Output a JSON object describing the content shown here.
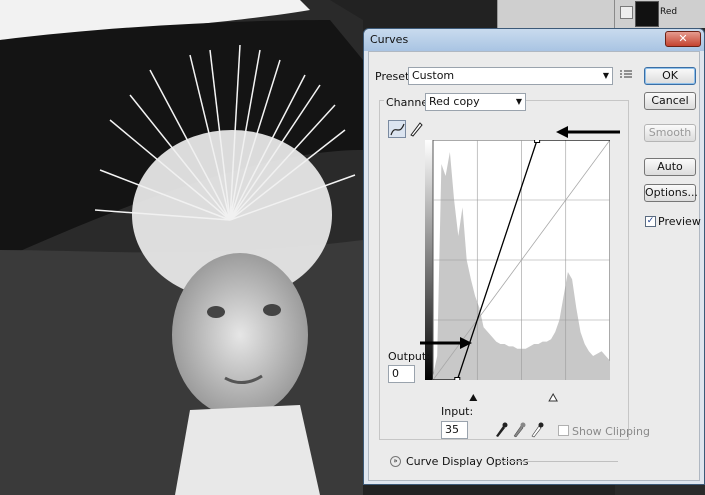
{
  "dialog": {
    "title": "Curves",
    "close_glyph": "✕",
    "preset_label": "Preset:",
    "preset_value": "Custom",
    "preset_menu_icon": "list-menu-icon",
    "channel_label": "Channel:",
    "channel_value": "Red copy",
    "output_label": "Output:",
    "output_value": "0",
    "input_label": "Input:",
    "input_value": "35",
    "show_clipping_label": "Show Clipping",
    "show_clipping_checked": false,
    "display_options_label": "Curve Display Options",
    "buttons": {
      "ok": "OK",
      "cancel": "Cancel",
      "smooth": "Smooth",
      "auto": "Auto",
      "options": "Options..."
    },
    "preview_label": "Preview",
    "preview_checked": true
  },
  "curve": {
    "input_range": [
      0,
      255
    ],
    "output_range": [
      0,
      255
    ],
    "points": [
      [
        35,
        0
      ],
      [
        150,
        255
      ]
    ],
    "curve_color": "#000000",
    "grid_color": "#9a9a9a",
    "histogram_color": "#c8c8c8"
  },
  "layers_panel": {
    "layer_name": "Red"
  }
}
